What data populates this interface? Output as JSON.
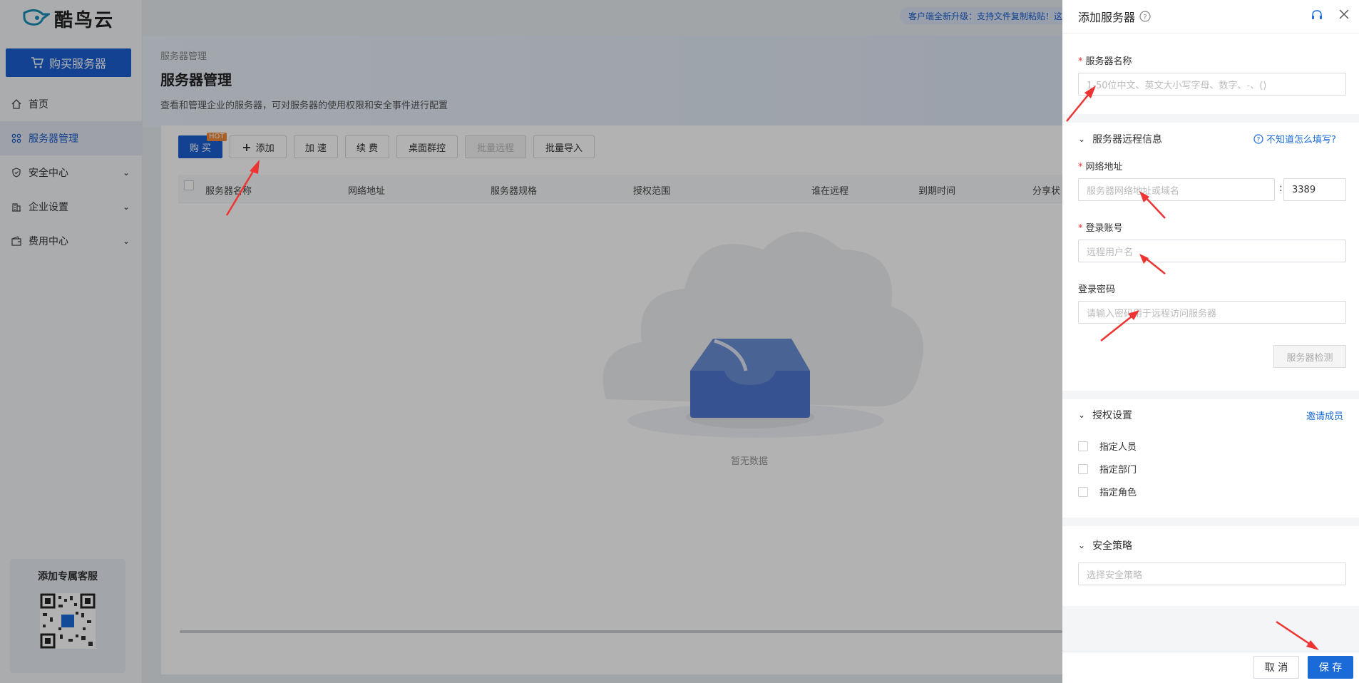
{
  "app": {
    "logo_text": "酷鸟云",
    "buy_button": "购买服务器",
    "banner": "客户端全新升级：支持文件复制粘贴！这"
  },
  "sidebar": {
    "items": [
      {
        "label": "首页",
        "icon": "home-icon"
      },
      {
        "label": "服务器管理",
        "icon": "grid-icon",
        "active": true
      },
      {
        "label": "安全中心",
        "icon": "shield-icon",
        "expandable": true
      },
      {
        "label": "企业设置",
        "icon": "building-icon",
        "expandable": true
      },
      {
        "label": "费用中心",
        "icon": "wallet-icon",
        "expandable": true
      }
    ],
    "service_card": {
      "title": "添加专属客服"
    }
  },
  "main": {
    "breadcrumb": "服务器管理",
    "title": "服务器管理",
    "description": "查看和管理企业的服务器，可对服务器的使用权限和安全事件进行配置",
    "toolbar": {
      "buy": "购 买",
      "hot": "HOT",
      "add": "添加",
      "accelerate": "加 速",
      "renew": "续 费",
      "group_control": "桌面群控",
      "batch_remote": "批量远程",
      "batch_import": "批量导入"
    },
    "columns": [
      "服务器名称",
      "网络地址",
      "服务器规格",
      "授权范围",
      "谁在远程",
      "到期时间",
      "分享状"
    ],
    "empty_text": "暂无数据"
  },
  "drawer": {
    "title": "添加服务器",
    "server_name": {
      "label": "服务器名称",
      "placeholder": "1-50位中文、英文大小写字母、数字、-、()"
    },
    "remote_section": {
      "title": "服务器远程信息",
      "help_link": "不知道怎么填写?"
    },
    "address": {
      "label": "网络地址",
      "placeholder": "服务器网络地址或域名",
      "port": "3389"
    },
    "account": {
      "label": "登录账号",
      "placeholder": "远程用户名"
    },
    "password": {
      "label": "登录密码",
      "placeholder": "请输入密码用于远程访问服务器"
    },
    "detect_button": "服务器检测",
    "auth_section": {
      "title": "授权设置",
      "invite_link": "邀请成员",
      "options": [
        "指定人员",
        "指定部门",
        "指定角色"
      ]
    },
    "security_section": {
      "title": "安全策略",
      "placeholder": "选择安全策略"
    },
    "cancel_button": "取 消",
    "save_button": "保 存"
  },
  "colors": {
    "primary": "#1a5fd0",
    "required": "#e33333",
    "arrow": "#ee3333"
  }
}
